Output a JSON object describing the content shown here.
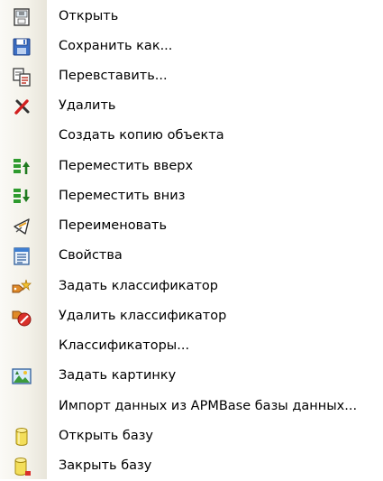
{
  "menu": {
    "items": [
      {
        "label": "Открыть",
        "icon": "open-document-icon"
      },
      {
        "label": "Сохранить как...",
        "icon": "floppy-disk-icon"
      },
      {
        "label": "Перевставить...",
        "icon": "reinsert-documents-icon"
      },
      {
        "label": "Удалить",
        "icon": "red-cross-delete-icon"
      },
      {
        "label": "Создать копию объекта",
        "icon": ""
      },
      {
        "label": "Переместить вверх",
        "icon": "move-up-icon"
      },
      {
        "label": "Переместить вниз",
        "icon": "move-down-icon"
      },
      {
        "label": "Переименовать",
        "icon": "rename-pen-icon"
      },
      {
        "label": "Свойства",
        "icon": "properties-sheet-icon"
      },
      {
        "label": "Задать классификатор",
        "icon": "set-classifier-icon"
      },
      {
        "label": "Удалить классификатор",
        "icon": "remove-classifier-icon"
      },
      {
        "label": "Классификаторы...",
        "icon": ""
      },
      {
        "label": "Задать картинку",
        "icon": "picture-icon"
      },
      {
        "label": "Импорт данных из APMBase базы данных...",
        "icon": ""
      },
      {
        "label": "Открыть базу",
        "icon": "database-cylinder-icon"
      },
      {
        "label": "Закрыть базу",
        "icon": "close-database-icon"
      }
    ]
  }
}
